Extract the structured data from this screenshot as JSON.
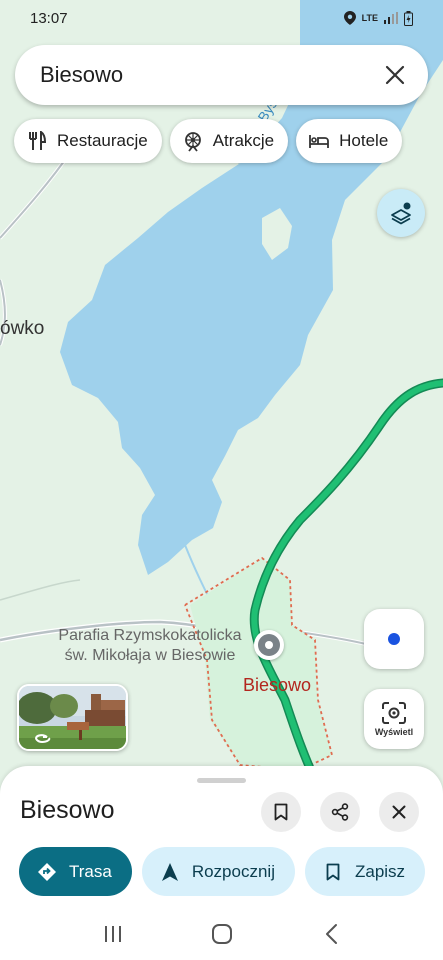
{
  "status_bar": {
    "time": "13:07",
    "network": "LTE"
  },
  "search": {
    "query": "Biesowo"
  },
  "chips": [
    {
      "label": "Restauracje",
      "icon": "restaurant-icon"
    },
    {
      "label": "Atrakcje",
      "icon": "attractions-icon"
    },
    {
      "label": "Hotele",
      "icon": "hotel-icon"
    }
  ],
  "map": {
    "labels": {
      "partial_place": "ówko",
      "lake": "Jezioro Bystrymy",
      "church_line1": "Parafia Rzymskokatolicka",
      "church_line2": "św. Mikołaja w Biesowie",
      "town": "Biesowo"
    },
    "colors": {
      "land": "#e4f2e6",
      "water": "#9fd1ec",
      "route": "#1fbf73",
      "boundary": "#e06c50"
    }
  },
  "controls": {
    "lens_label": "Wyświetl"
  },
  "sheet": {
    "title": "Biesowo",
    "actions": [
      {
        "label": "Trasa",
        "icon": "directions-icon"
      },
      {
        "label": "Rozpocznij",
        "icon": "navigation-icon"
      },
      {
        "label": "Zapisz",
        "icon": "bookmark-icon"
      }
    ]
  }
}
